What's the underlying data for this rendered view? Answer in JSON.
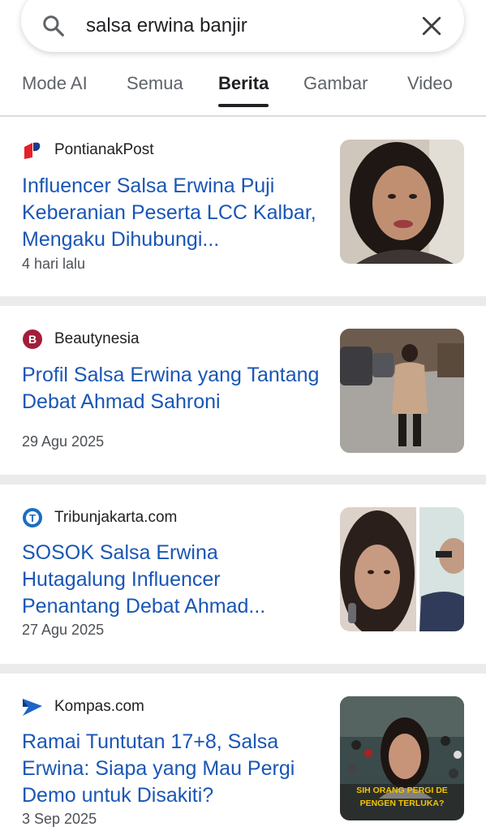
{
  "search": {
    "query": "salsa erwina banjir"
  },
  "tabs": [
    {
      "label": "Mode AI"
    },
    {
      "label": "Semua"
    },
    {
      "label": "Berita",
      "active": true
    },
    {
      "label": "Gambar"
    },
    {
      "label": "Video"
    }
  ],
  "results": [
    {
      "source": "PontianakPost",
      "headline": "Influencer Salsa Erwina Puji Keberanian Peserta LCC Kalbar, Mengaku Dihubungi...",
      "date": "4 hari lalu",
      "logo_icon": "pontianakpost-logo-icon",
      "logo_color": "#e5202a"
    },
    {
      "source": "Beautynesia",
      "headline": "Profil Salsa Erwina yang Tantang Debat Ahmad Sahroni",
      "date": "29 Agu 2025",
      "logo_icon": "beautynesia-logo-icon",
      "logo_color": "#a31d3a"
    },
    {
      "source": "Tribunjakarta.com",
      "headline": "SOSOK Salsa Erwina Hutagalung Influencer Penantang Debat Ahmad...",
      "date": "27 Agu 2025",
      "logo_icon": "tribun-logo-icon",
      "logo_color": "#1b6ec2"
    },
    {
      "source": "Kompas.com",
      "headline": "Ramai Tuntutan 17+8, Salsa Erwina: Siapa yang Mau Pergi Demo untuk Disakiti?",
      "date": "3 Sep 2025",
      "logo_icon": "kompas-logo-icon",
      "logo_color": "#1e64c8",
      "thumb_caption_1": "SIH ORANG PERGI DE",
      "thumb_caption_2": "PENGEN TERLUKA?"
    }
  ],
  "colors": {
    "link": "#1a56b5",
    "separator": "#ebebeb",
    "caption": "#f5c400"
  }
}
